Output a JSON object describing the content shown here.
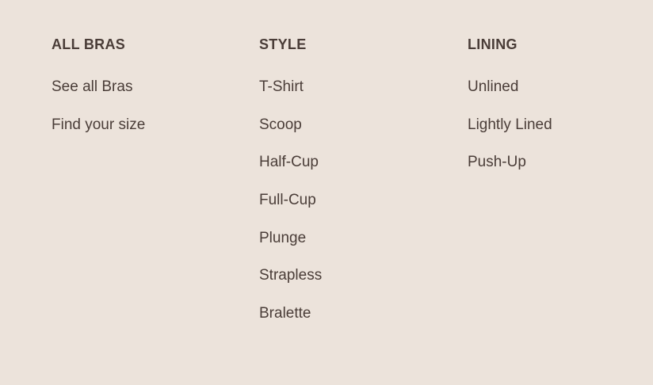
{
  "columns": [
    {
      "heading": "ALL BRAS",
      "links": [
        "See all Bras",
        "Find your size"
      ]
    },
    {
      "heading": "STYLE",
      "links": [
        "T-Shirt",
        "Scoop",
        "Half-Cup",
        "Full-Cup",
        "Plunge",
        "Strapless",
        "Bralette"
      ]
    },
    {
      "heading": "LINING",
      "links": [
        "Unlined",
        "Lightly Lined",
        "Push-Up"
      ]
    }
  ],
  "colors": {
    "background": "#ECE3DB",
    "text": "#4A3D38"
  }
}
